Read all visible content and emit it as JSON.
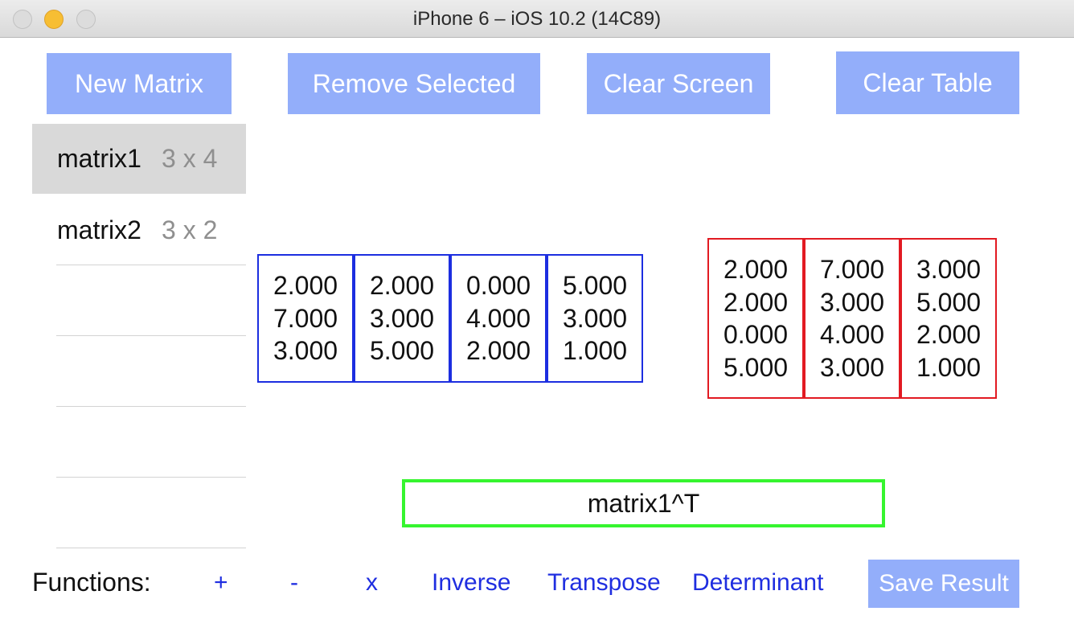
{
  "window": {
    "title": "iPhone 6 – iOS 10.2 (14C89)"
  },
  "toolbar": {
    "new_matrix": "New Matrix",
    "remove_selected": "Remove Selected",
    "clear_screen": "Clear Screen",
    "clear_table": "Clear Table"
  },
  "matrix_list": [
    {
      "name": "matrix1",
      "dims": "3 x 4",
      "selected": true
    },
    {
      "name": "matrix2",
      "dims": "3 x 2",
      "selected": false
    }
  ],
  "input_matrix": {
    "rows": 3,
    "cols": 4,
    "border_color": "#1c2ee0",
    "columns": [
      [
        "2.000",
        "7.000",
        "3.000"
      ],
      [
        "2.000",
        "3.000",
        "5.000"
      ],
      [
        "0.000",
        "4.000",
        "2.000"
      ],
      [
        "5.000",
        "3.000",
        "1.000"
      ]
    ]
  },
  "result_matrix": {
    "rows": 4,
    "cols": 3,
    "border_color": "#e21a22",
    "columns": [
      [
        "2.000",
        "2.000",
        "0.000",
        "5.000"
      ],
      [
        "7.000",
        "3.000",
        "4.000",
        "3.000"
      ],
      [
        "3.000",
        "5.000",
        "2.000",
        "1.000"
      ]
    ]
  },
  "expression": {
    "text": "matrix1^T",
    "border_color": "#36f52f"
  },
  "functions": {
    "label": "Functions:",
    "items": [
      "+",
      "-",
      "x",
      "Inverse",
      "Transpose",
      "Determinant"
    ],
    "save_label": "Save Result"
  },
  "colors": {
    "button_bg": "#93aefa",
    "link": "#1f2ee0"
  }
}
